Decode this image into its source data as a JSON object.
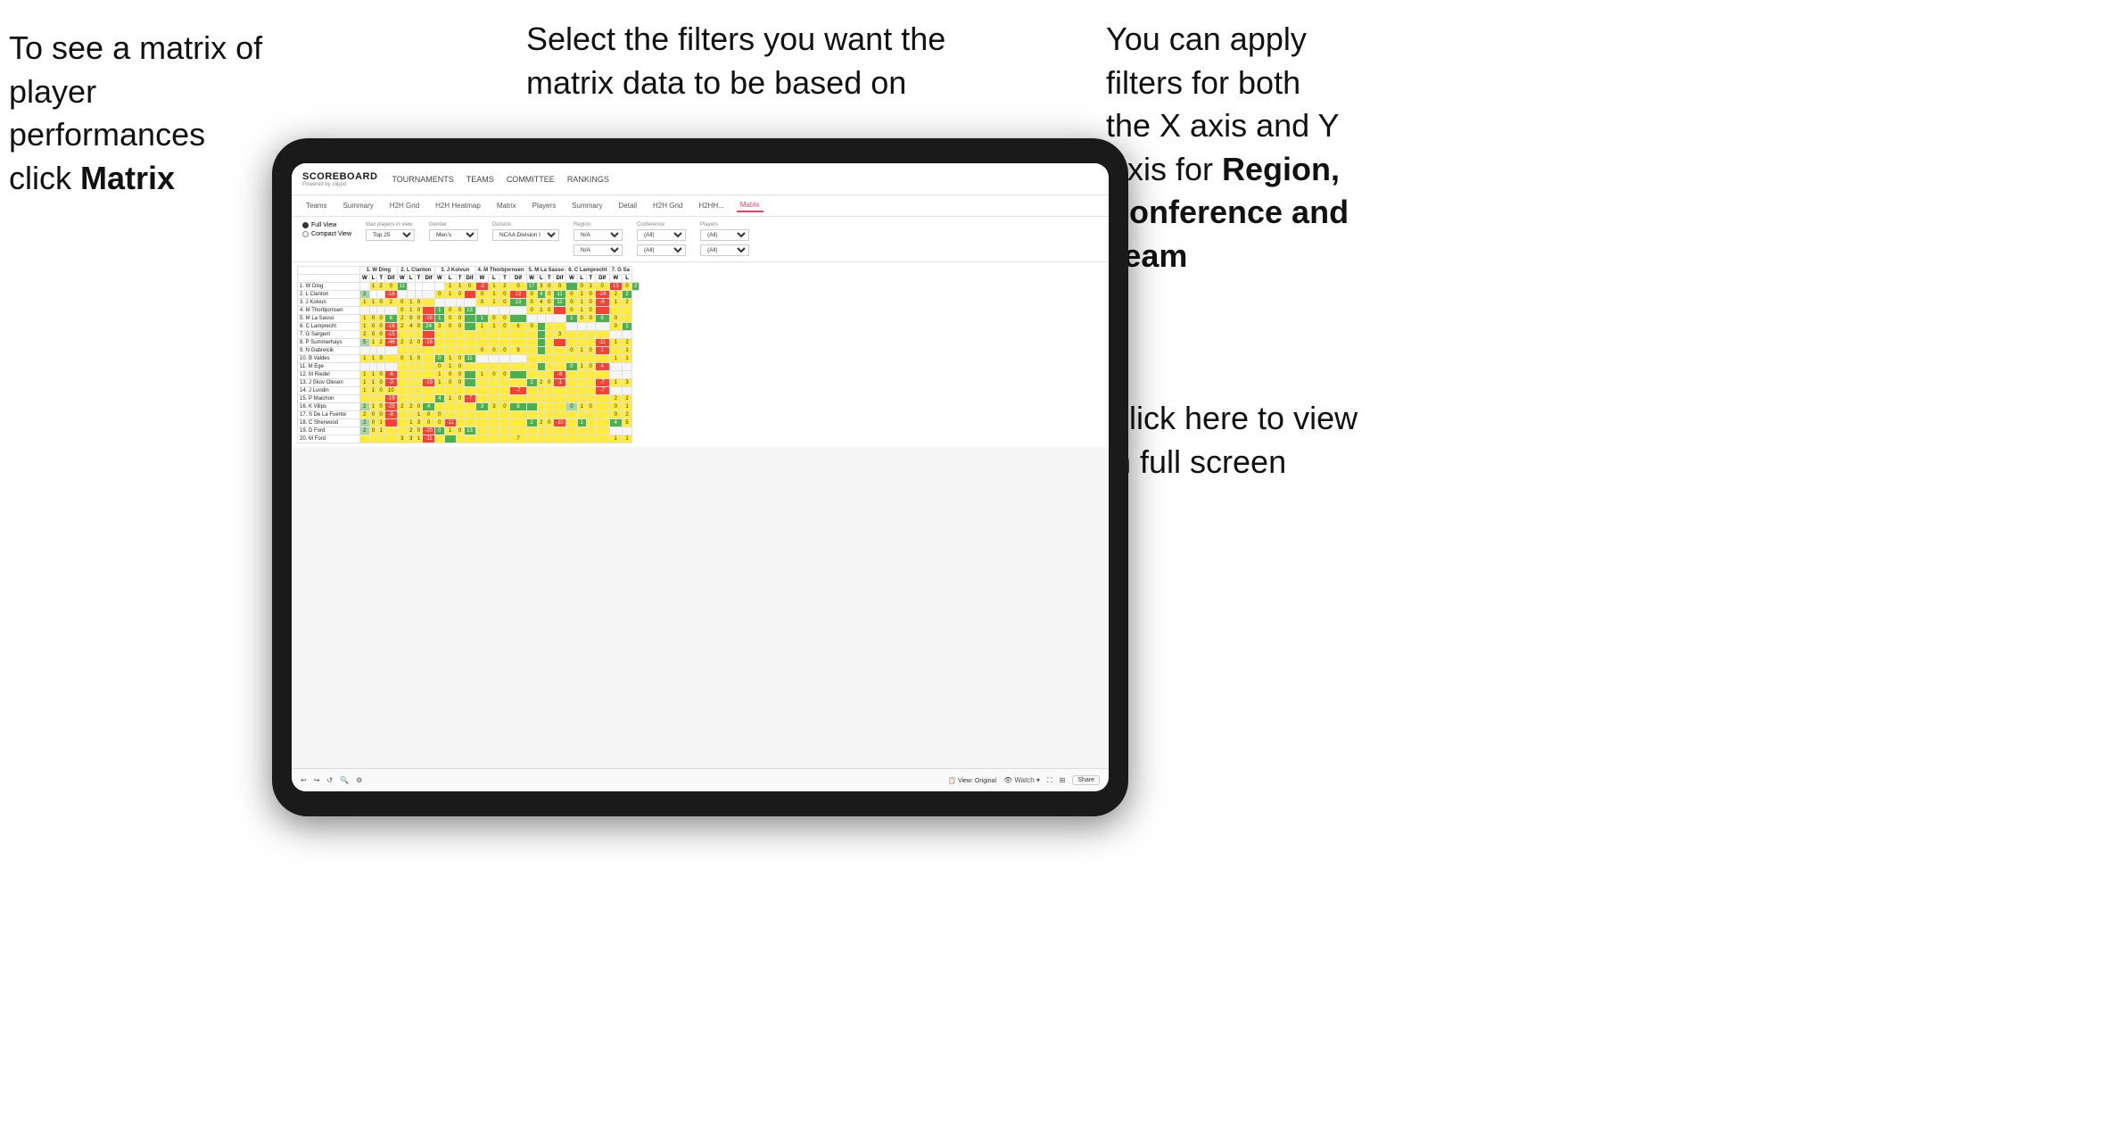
{
  "annotations": {
    "topleft": {
      "line1": "To see a matrix of",
      "line2": "player performances",
      "line3_normal": "click ",
      "line3_bold": "Matrix"
    },
    "topcenter": {
      "text": "Select the filters you want the matrix data to be based on"
    },
    "topright": {
      "line1": "You  can apply",
      "line2": "filters for both",
      "line3": "the X axis and Y",
      "line4_normal": "Axis for ",
      "line4_bold": "Region,",
      "line5_bold": "Conference and",
      "line6_bold": "Team"
    },
    "bottomright": {
      "line1": "Click here to view",
      "line2": "in full screen"
    }
  },
  "app": {
    "logo": "SCOREBOARD",
    "logo_sub": "Powered by clippd",
    "nav": [
      "TOURNAMENTS",
      "TEAMS",
      "COMMITTEE",
      "RANKINGS"
    ],
    "sub_nav": [
      "Teams",
      "Summary",
      "H2H Grid",
      "H2H Heatmap",
      "Matrix",
      "Players",
      "Summary",
      "Detail",
      "H2H Grid",
      "H2HH...",
      "Matrix"
    ],
    "active_tab": "Matrix"
  },
  "filters": {
    "view_options": [
      "Full View",
      "Compact View"
    ],
    "selected_view": "Full View",
    "max_players_label": "Max players in view",
    "max_players_value": "Top 25",
    "gender_label": "Gender",
    "gender_value": "Men's",
    "division_label": "Division",
    "division_value": "NCAA Division I",
    "region_label": "Region",
    "region_value": "N/A",
    "conference_label": "Conference",
    "conference_value": "(All)",
    "players_label": "Players",
    "players_value": "(All)"
  },
  "matrix": {
    "col_headers": [
      "1. W Ding",
      "2. L Clanton",
      "3. J Koivun",
      "4. M Thorbjornsen",
      "5. M La Sasso",
      "6. C Lamprecht",
      "7. G Sa"
    ],
    "sub_headers": [
      "W",
      "L",
      "T",
      "Dif"
    ],
    "rows": [
      {
        "name": "1. W Ding",
        "cells": [
          {
            "v": "",
            "c": "cell-white"
          },
          {
            "v": "1",
            "c": "cell-yellow"
          },
          {
            "v": "2",
            "c": "cell-yellow"
          },
          {
            "v": "0",
            "c": "cell-yellow"
          },
          {
            "v": "11",
            "c": "cell-green"
          }
        ]
      },
      {
        "name": "2. L Clanton",
        "cells": [
          {
            "v": "2",
            "c": "cell-light-green"
          },
          {
            "v": "",
            "c": "cell-white"
          },
          {
            "v": "1",
            "c": "cell-yellow"
          },
          {
            "v": "1",
            "c": "cell-yellow"
          },
          {
            "v": "0",
            "c": "cell-yellow"
          }
        ]
      },
      {
        "name": "3. J Koivun",
        "cells": [
          {
            "v": "1",
            "c": "cell-yellow"
          },
          {
            "v": "1",
            "c": "cell-yellow"
          },
          {
            "v": "0",
            "c": "cell-yellow"
          },
          {
            "v": "2",
            "c": "cell-green"
          }
        ]
      },
      {
        "name": "4. M Thorbjornsen",
        "cells": []
      },
      {
        "name": "5. M La Sasso",
        "cells": []
      },
      {
        "name": "6. C Lamprecht",
        "cells": []
      },
      {
        "name": "7. G Sargent",
        "cells": []
      },
      {
        "name": "8. P Summerhays",
        "cells": []
      },
      {
        "name": "9. N Gabrelcik",
        "cells": []
      },
      {
        "name": "10. B Valdes",
        "cells": []
      },
      {
        "name": "11. M Ege",
        "cells": []
      },
      {
        "name": "12. M Riedel",
        "cells": []
      },
      {
        "name": "13. J Skov Olesen",
        "cells": []
      },
      {
        "name": "14. J Lundin",
        "cells": []
      },
      {
        "name": "15. P Maichon",
        "cells": []
      },
      {
        "name": "16. K Vilips",
        "cells": []
      },
      {
        "name": "17. S De La Fuente",
        "cells": []
      },
      {
        "name": "18. C Sherwood",
        "cells": []
      },
      {
        "name": "19. D Ford",
        "cells": []
      },
      {
        "name": "20. M Ford",
        "cells": []
      }
    ]
  },
  "toolbar": {
    "view_label": "View: Original",
    "watch_label": "Watch",
    "share_label": "Share"
  }
}
